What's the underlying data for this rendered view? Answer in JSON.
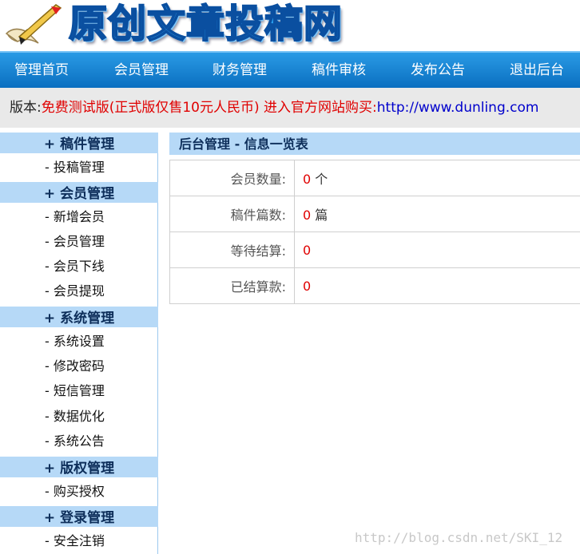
{
  "header": {
    "logo_text": "原创文章投稿网"
  },
  "nav": [
    {
      "label": "管理首页"
    },
    {
      "label": "会员管理"
    },
    {
      "label": "财务管理"
    },
    {
      "label": "稿件审核"
    },
    {
      "label": "发布公告"
    },
    {
      "label": "退出后台"
    }
  ],
  "version": {
    "label": "版本:",
    "edition": "免费测试版(正式版仅售10元人民币) 进入官方网站购买:",
    "url": "http://www.dunling.com"
  },
  "sidebar": {
    "groups": [
      {
        "title": "+ 稿件管理",
        "items": [
          "- 投稿管理"
        ]
      },
      {
        "title": "+ 会员管理",
        "items": [
          "- 新增会员",
          "- 会员管理",
          "- 会员下线",
          "- 会员提现"
        ]
      },
      {
        "title": "+ 系统管理",
        "items": [
          "- 系统设置",
          "- 修改密码",
          "- 短信管理",
          "- 数据优化",
          "- 系统公告"
        ]
      },
      {
        "title": "+ 版权管理",
        "items": [
          "- 购买授权"
        ]
      },
      {
        "title": "+ 登录管理",
        "items": [
          "- 安全注销"
        ]
      }
    ]
  },
  "main": {
    "title": "后台管理 - 信息一览表",
    "rows": [
      {
        "label": "会员数量:",
        "value": "0",
        "unit": " 个"
      },
      {
        "label": "稿件篇数:",
        "value": "0",
        "unit": " 篇"
      },
      {
        "label": "等待结算:",
        "value": "0",
        "unit": ""
      },
      {
        "label": "已结算款:",
        "value": "0",
        "unit": ""
      }
    ]
  },
  "watermark": "http://blog.csdn.net/SKI_12",
  "colors": {
    "nav_bg": "#0a6fc0",
    "group_bg": "#b6d9f7",
    "highlight": "#e00000",
    "link": "#0000cc"
  }
}
